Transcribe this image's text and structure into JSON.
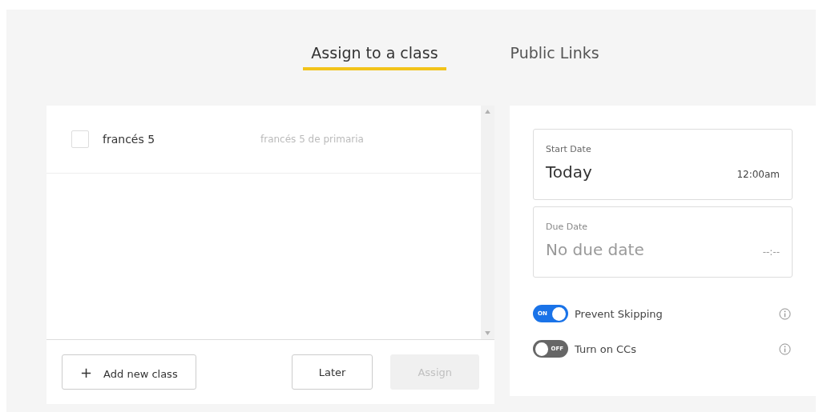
{
  "tabs": [
    {
      "label": "Assign to a class",
      "selected": true
    },
    {
      "label": "Public Links",
      "selected": false
    }
  ],
  "classes": [
    {
      "name": "francés 5",
      "description": "francés 5 de primaria",
      "checked": false
    }
  ],
  "add_button": {
    "icon": "+",
    "label": "Add new class"
  },
  "later_button": {
    "label": "Later",
    "disabled": false
  },
  "assign_button": {
    "label": "Assign",
    "disabled": true
  },
  "start_date": {
    "label": "Start Date",
    "value": "Today",
    "time": "12:00am",
    "empty": false
  },
  "due_date": {
    "label": "Due Date",
    "value": "No due date",
    "time": "--:--",
    "empty": true
  },
  "toggles": [
    {
      "label": "Prevent Skipping",
      "on": true,
      "state_text": "ON"
    },
    {
      "label": "Turn on CCs",
      "on": false,
      "state_text": "OFF"
    }
  ]
}
